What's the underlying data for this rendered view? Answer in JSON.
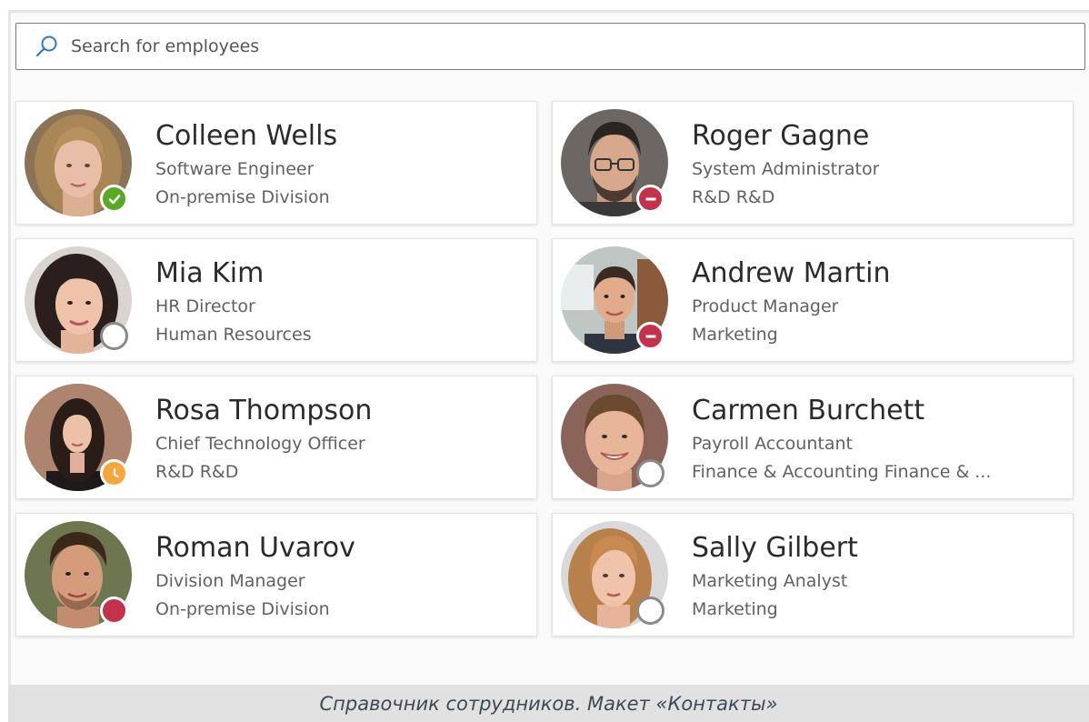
{
  "search": {
    "placeholder": "Search for employees",
    "icon": "search-icon"
  },
  "employees": [
    {
      "name": "Colleen Wells",
      "title": "Software Engineer",
      "department": "On-premise Division",
      "status": "available",
      "status_color": "#5aa823"
    },
    {
      "name": "Roger Gagne",
      "title": "System Administrator",
      "department": "R&D R&D",
      "status": "busy",
      "status_color": "#c4314b"
    },
    {
      "name": "Mia Kim",
      "title": "HR Director",
      "department": "Human Resources",
      "status": "offline",
      "status_color": "#8a8a8a"
    },
    {
      "name": "Andrew Martin",
      "title": "Product Manager",
      "department": "Marketing",
      "status": "busy",
      "status_color": "#c4314b"
    },
    {
      "name": "Rosa Thompson",
      "title": "Chief Technology Officer",
      "department": "R&D R&D",
      "status": "away",
      "status_color": "#f7a73a"
    },
    {
      "name": "Carmen Burchett",
      "title": "Payroll Accountant",
      "department": "Finance & Accounting Finance & ...",
      "status": "offline",
      "status_color": "#8a8a8a"
    },
    {
      "name": "Roman Uvarov",
      "title": "Division Manager",
      "department": "On-premise Division",
      "status": "busy",
      "status_color": "#c4314b"
    },
    {
      "name": "Sally Gilbert",
      "title": "Marketing Analyst",
      "department": "Marketing",
      "status": "offline",
      "status_color": "#8a8a8a"
    }
  ],
  "caption": "Справочник сотрудников. Макет «Контакты»"
}
